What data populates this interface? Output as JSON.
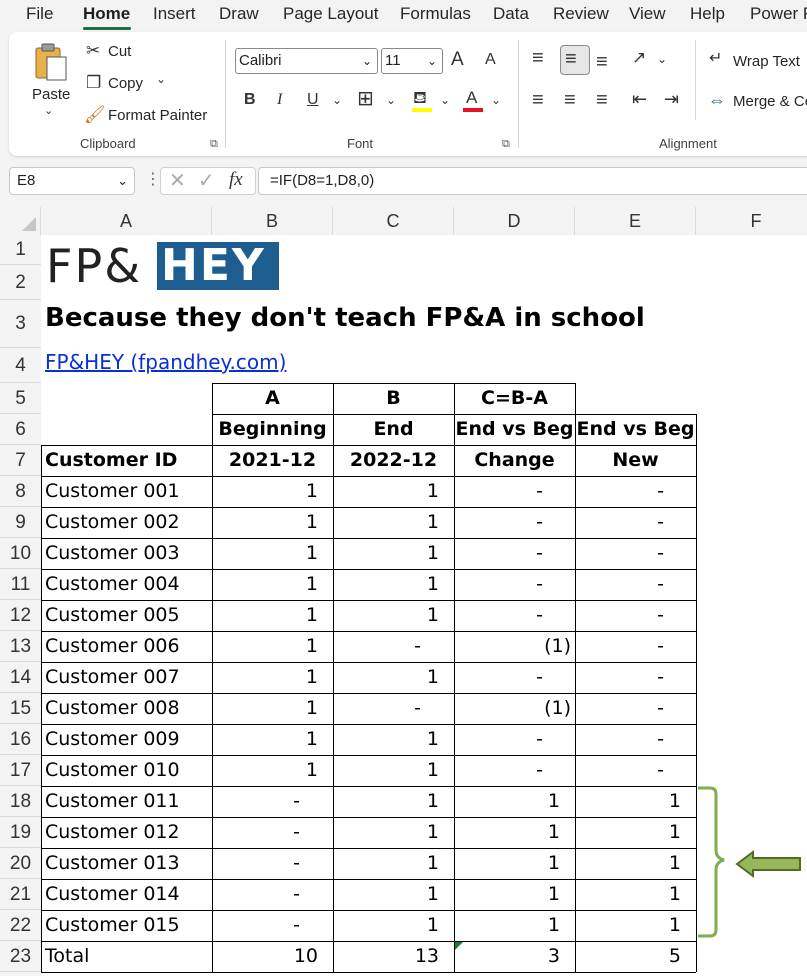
{
  "menu": {
    "tabs": [
      "File",
      "Home",
      "Insert",
      "Draw",
      "Page Layout",
      "Formulas",
      "Data",
      "Review",
      "View",
      "Help",
      "Power P"
    ],
    "active": "Home"
  },
  "ribbon": {
    "clipboard": {
      "paste": "Paste",
      "cut": "Cut",
      "copy": "Copy",
      "format_painter": "Format Painter",
      "label": "Clipboard"
    },
    "font": {
      "name": "Calibri",
      "size": "11",
      "label": "Font",
      "bold": "B",
      "italic": "I",
      "underline": "U",
      "grow": "A",
      "shrink": "A",
      "font_color": "A"
    },
    "alignment": {
      "wrap_text": "Wrap Text",
      "merge": "Merge & Ce",
      "label": "Alignment"
    }
  },
  "formula_bar": {
    "name_box": "E8",
    "formula": "=IF(D8=1,D8,0)",
    "fx": "fx"
  },
  "columns": [
    "A",
    "B",
    "C",
    "D",
    "E",
    "F"
  ],
  "rows": [
    "1",
    "2",
    "3",
    "4",
    "5",
    "6",
    "7",
    "8",
    "9",
    "10",
    "11",
    "12",
    "13",
    "14",
    "15",
    "16",
    "17",
    "18",
    "19",
    "20",
    "21",
    "22",
    "23"
  ],
  "sheet": {
    "logo_left": "FP&",
    "logo_right": "HEY",
    "tagline": "Because they don't teach FP&A in school",
    "link": "FP&HEY (fpandhey.com)",
    "header_row5": [
      "A",
      "B",
      "C=B-A"
    ],
    "header_row6": [
      "Beginning",
      "End",
      "End vs Beg",
      "End vs Beg"
    ],
    "header_row7": [
      "Customer ID",
      "2021-12",
      "2022-12",
      "Change",
      "New"
    ],
    "data": [
      [
        "Customer 001",
        "1",
        "1",
        "-",
        "-"
      ],
      [
        "Customer 002",
        "1",
        "1",
        "-",
        "-"
      ],
      [
        "Customer 003",
        "1",
        "1",
        "-",
        "-"
      ],
      [
        "Customer 004",
        "1",
        "1",
        "-",
        "-"
      ],
      [
        "Customer 005",
        "1",
        "1",
        "-",
        "-"
      ],
      [
        "Customer 006",
        "1",
        "-",
        "(1)",
        "-"
      ],
      [
        "Customer 007",
        "1",
        "1",
        "-",
        "-"
      ],
      [
        "Customer 008",
        "1",
        "-",
        "(1)",
        "-"
      ],
      [
        "Customer 009",
        "1",
        "1",
        "-",
        "-"
      ],
      [
        "Customer 010",
        "1",
        "1",
        "-",
        "-"
      ],
      [
        "Customer 011",
        "-",
        "1",
        "1",
        "1"
      ],
      [
        "Customer 012",
        "-",
        "1",
        "1",
        "1"
      ],
      [
        "Customer 013",
        "-",
        "1",
        "1",
        "1"
      ],
      [
        "Customer 014",
        "-",
        "1",
        "1",
        "1"
      ],
      [
        "Customer 015",
        "-",
        "1",
        "1",
        "1"
      ]
    ],
    "total": [
      "Total",
      "10",
      "13",
      "3",
      "5"
    ]
  },
  "colors": {
    "accent": "#1e6e42",
    "logo_blue": "#1d5d8f",
    "bracket_green": "#7fae4a",
    "arrow_green": "#6a8f3a"
  }
}
